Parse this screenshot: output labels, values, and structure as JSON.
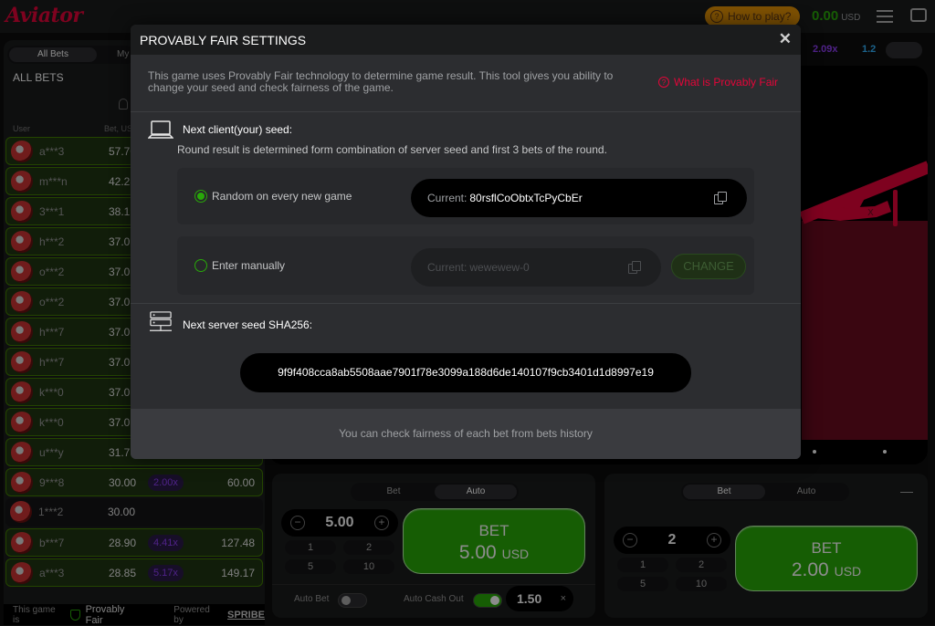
{
  "header": {
    "logo": "Aviator",
    "how_to_play": "How to play?",
    "balance": "0.00",
    "currency": "USD"
  },
  "bets_panel": {
    "tab_all": "All Bets",
    "tab_my": "My",
    "title": "ALL BETS",
    "col_user": "User",
    "col_bet": "Bet, USD",
    "rows": [
      {
        "user": "a***3",
        "bet": "57.70",
        "mult": "",
        "win": "",
        "won": true
      },
      {
        "user": "m***n",
        "bet": "42.28",
        "mult": "",
        "win": "",
        "won": true
      },
      {
        "user": "3***1",
        "bet": "38.19",
        "mult": "",
        "win": "",
        "won": true
      },
      {
        "user": "h***2",
        "bet": "37.07",
        "mult": "",
        "win": "",
        "won": true
      },
      {
        "user": "o***2",
        "bet": "37.07",
        "mult": "",
        "win": "",
        "won": true
      },
      {
        "user": "o***2",
        "bet": "37.07",
        "mult": "",
        "win": "",
        "won": true
      },
      {
        "user": "h***7",
        "bet": "37.07",
        "mult": "",
        "win": "",
        "won": true
      },
      {
        "user": "h***7",
        "bet": "37.07",
        "mult": "",
        "win": "",
        "won": true
      },
      {
        "user": "k***0",
        "bet": "37.07",
        "mult": "",
        "win": "",
        "won": true
      },
      {
        "user": "k***0",
        "bet": "37.07",
        "mult": "",
        "win": "",
        "won": true
      },
      {
        "user": "u***y",
        "bet": "31.77",
        "mult": "",
        "win": "",
        "won": true
      },
      {
        "user": "9***8",
        "bet": "30.00",
        "mult": "2.00x",
        "win": "60.00",
        "won": true
      },
      {
        "user": "1***2",
        "bet": "30.00",
        "mult": "",
        "win": "",
        "won": false
      },
      {
        "user": "b***7",
        "bet": "28.90",
        "mult": "4.41x",
        "win": "127.48",
        "won": true
      },
      {
        "user": "a***3",
        "bet": "28.85",
        "mult": "5.17x",
        "win": "149.17",
        "won": true
      }
    ],
    "footer_text": "This game is",
    "footer_pf": "Provably Fair",
    "footer_powered": "Powered by",
    "footer_brand": "SPRIBE"
  },
  "history": {
    "values": [
      "2.09x",
      "1.2"
    ]
  },
  "bet_panel_1": {
    "tab_bet": "Bet",
    "tab_auto": "Auto",
    "amount": "5.00",
    "quick": [
      "1",
      "2",
      "5",
      "10"
    ],
    "button_label": "BET",
    "button_amount": "5.00",
    "button_currency": "USD",
    "auto_bet_label": "Auto Bet",
    "auto_cashout_label": "Auto Cash Out",
    "cashout_value": "1.50"
  },
  "bet_panel_2": {
    "tab_bet": "Bet",
    "tab_auto": "Auto",
    "amount": "2",
    "quick": [
      "1",
      "2",
      "5",
      "10"
    ],
    "button_label": "BET",
    "button_amount": "2.00",
    "button_currency": "USD"
  },
  "modal": {
    "title": "PROVABLY FAIR SETTINGS",
    "intro": "This game uses Provably Fair technology to determine game result. This tool gives you ability to change your seed and check fairness of the game.",
    "what_is_link": "What is Provably Fair",
    "client_seed_title": "Next client(your) seed:",
    "client_seed_desc": "Round result is determined form combination of server seed and first 3 bets of the round.",
    "option_random": "Random on every new game",
    "current_prefix": "Current:",
    "random_seed": "80rsflCoObtxTcPyCbEr",
    "option_manual": "Enter manually",
    "manual_seed": "wewewew-0",
    "change_button": "CHANGE",
    "server_seed_title": "Next server seed SHA256:",
    "server_hash": "9f9f408cca8ab5508aae7901f78e3099a188d6de140107f9cb3401d1d8997e19",
    "footer": "You can check fairness of each bet from bets history"
  },
  "colors": {
    "accent_red": "#e50539",
    "accent_green": "#28a909",
    "multiplier_purple": "#913ef8"
  }
}
